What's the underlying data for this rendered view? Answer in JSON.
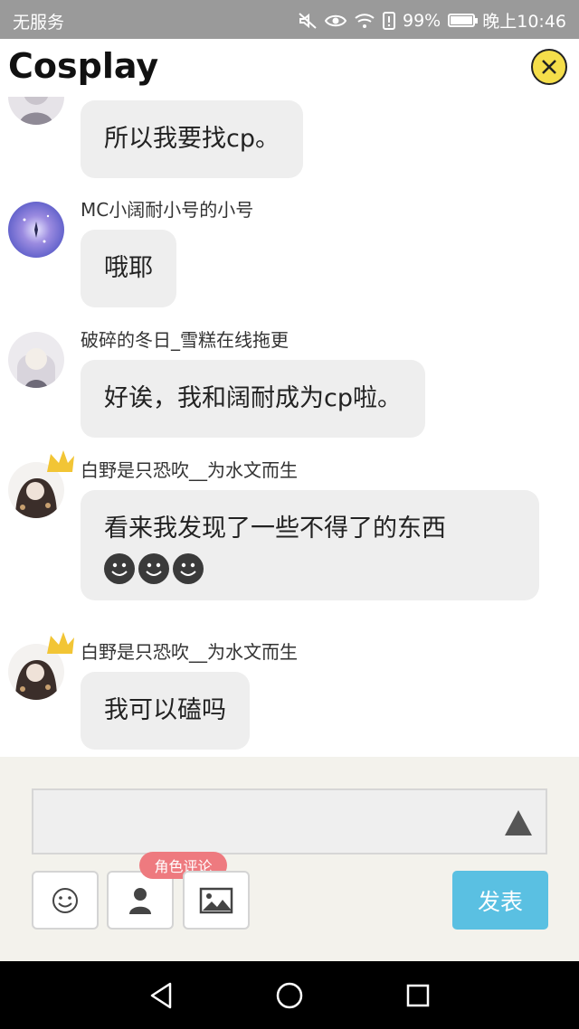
{
  "status_bar": {
    "carrier": "无服务",
    "battery": "99%",
    "time": "晚上10:46",
    "battery_level": 0.99
  },
  "header": {
    "title": "Cosplay"
  },
  "messages": [
    {
      "sender": "",
      "lines": [
        "所以我要找cp。"
      ],
      "avatar": "avatar-white-hair"
    },
    {
      "sender": "MC小阔耐小号的小号",
      "lines": [
        "哦耶"
      ],
      "avatar": "avatar-galaxy"
    },
    {
      "sender": "破碎的冬日_雪糕在线拖更",
      "lines": [
        "好诶，我和阔耐成为cp啦。"
      ],
      "avatar": "avatar-white-hair"
    },
    {
      "sender": "白野是只恐吹__为水文而生",
      "lines": [
        "看来我发现了一些不得了的东西"
      ],
      "emoji_count": 3,
      "avatar": "avatar-crown"
    },
    {
      "sender": "白野是只恐吹__为水文而生",
      "lines": [
        "我可以磕吗"
      ],
      "avatar": "avatar-crown"
    }
  ],
  "composer": {
    "input_value": "",
    "role_badge": "角色评论",
    "publish_label": "发表"
  },
  "icons": {
    "close": "close-icon",
    "emoji": "smiley-icon",
    "role": "person-icon",
    "image": "image-icon",
    "send_triangle": "triangle-up-icon"
  },
  "colors": {
    "status_bar": "#9a9a9a",
    "close_button": "#f5de4a",
    "bubble": "#eeeeee",
    "role_badge": "#ee7a7f",
    "publish_button": "#5ac0e2"
  }
}
